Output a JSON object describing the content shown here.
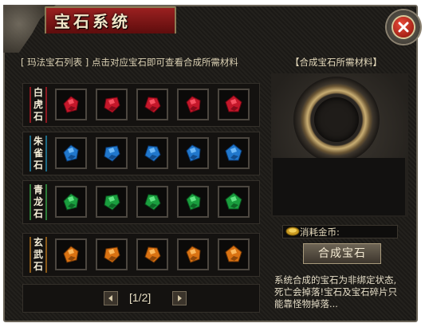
{
  "window": {
    "title": "宝石系统"
  },
  "colors": {
    "red": "#d8202c",
    "blue": "#2a7fd6",
    "green": "#1fae44",
    "orange": "#e27a14"
  },
  "gem_list": {
    "header": "[ 玛法宝石列表 ] 点击对应宝石即可查看合成所需材料",
    "rows": [
      {
        "label_chars": [
          "白",
          "虎",
          "石"
        ],
        "color": "red"
      },
      {
        "label_chars": [
          "朱",
          "雀",
          "石"
        ],
        "color": "blue"
      },
      {
        "label_chars": [
          "青",
          "龙",
          "石"
        ],
        "color": "green"
      },
      {
        "label_chars": [
          "玄",
          "武",
          "石"
        ],
        "color": "orange"
      }
    ],
    "gems_per_row": 5
  },
  "pager": {
    "text": "[1/2]"
  },
  "materials": {
    "header": "【合成宝石所需材料】",
    "coin_label": "消耗金币:",
    "compose_button": "合成宝石",
    "notice_lines": [
      "系统合成的宝石为非绑定状态,",
      "死亡会掉落!宝石及宝石碎片只",
      "能靠怪物掉落..."
    ]
  },
  "icons": {
    "close": "close-icon",
    "prev": "arrow-left-icon",
    "next": "arrow-right-icon",
    "coin": "gold-coin-icon",
    "gem": "gem-icon"
  }
}
